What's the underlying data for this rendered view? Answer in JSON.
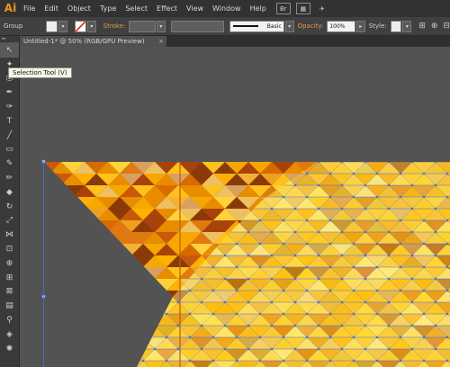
{
  "app": {
    "logo": "Ai"
  },
  "menu": [
    "File",
    "Edit",
    "Object",
    "Type",
    "Select",
    "Effect",
    "View",
    "Window",
    "Help"
  ],
  "control_bar": {
    "selection_label": "Group",
    "stroke_label": "Stroke:",
    "stroke_style": "Basic",
    "opacity_label": "Opacity:",
    "opacity_value": "100%",
    "style_label": "Style:"
  },
  "document": {
    "tab_title": "Untitled-1* @ 50% (RGB/GPU Preview)",
    "close": "×"
  },
  "tooltip": "Selection Tool (V)",
  "colors": {
    "ui_dark": "#323232",
    "canvas_bg": "#535353",
    "accent": "#f7941d",
    "selection_blue": "#4a6fe0"
  }
}
